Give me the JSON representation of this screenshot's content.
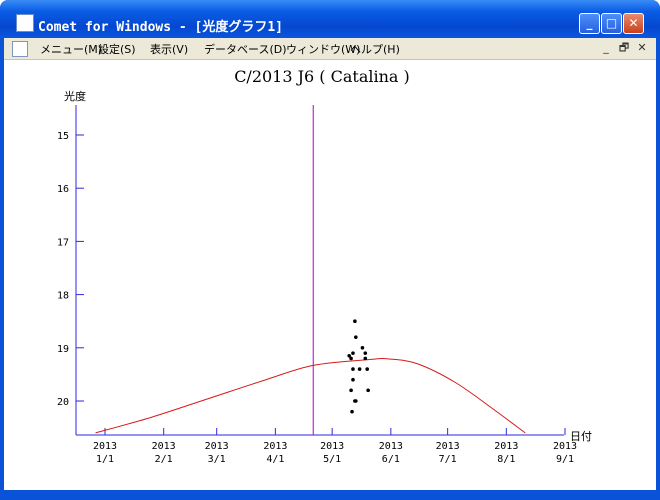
{
  "window": {
    "title": "Comet for Windows - [光度グラフ1]",
    "controls": [
      "_",
      "□",
      "✕"
    ]
  },
  "menu": {
    "items": [
      "メニュー(M)",
      "設定(S)",
      "表示(V)",
      "データベース(D)",
      "ウィンドウ(W)",
      "ヘルプ(H)"
    ],
    "mdi_controls": [
      "_",
      "🗗",
      "✕"
    ]
  },
  "chart_data": {
    "type": "scatter",
    "title": "C/2013 J6 ( Catalina )",
    "ylabel": "光度",
    "xlabel": "日付",
    "y_ticks": [
      "15",
      "16",
      "17",
      "18",
      "19",
      "20"
    ],
    "x_ticks": [
      {
        "year": "2013",
        "day": "1/1"
      },
      {
        "year": "2013",
        "day": "2/1"
      },
      {
        "year": "2013",
        "day": "3/1"
      },
      {
        "year": "2013",
        "day": "4/1"
      },
      {
        "year": "2013",
        "day": "5/1"
      },
      {
        "year": "2013",
        "day": "6/1"
      },
      {
        "year": "2013",
        "day": "7/1"
      },
      {
        "year": "2013",
        "day": "8/1"
      },
      {
        "year": "2013",
        "day": "9/1"
      }
    ],
    "y_inverted": true,
    "ylim": [
      14.5,
      20.6
    ],
    "xlim_days": [
      -10,
      245
    ],
    "date_marker_day": 110,
    "observations": [
      {
        "day": 132.0,
        "mag": 18.5
      },
      {
        "day": 132.5,
        "mag": 18.8
      },
      {
        "day": 131.0,
        "mag": 19.1
      },
      {
        "day": 129.0,
        "mag": 19.15
      },
      {
        "day": 136.0,
        "mag": 19.0
      },
      {
        "day": 137.5,
        "mag": 19.1
      },
      {
        "day": 137.5,
        "mag": 19.2
      },
      {
        "day": 130.0,
        "mag": 19.2
      },
      {
        "day": 131.0,
        "mag": 19.4
      },
      {
        "day": 134.5,
        "mag": 19.4
      },
      {
        "day": 138.5,
        "mag": 19.4
      },
      {
        "day": 131.0,
        "mag": 19.6
      },
      {
        "day": 130.0,
        "mag": 19.8
      },
      {
        "day": 139.0,
        "mag": 19.8
      },
      {
        "day": 132.5,
        "mag": 20.0
      },
      {
        "day": 132.0,
        "mag": 20.0
      },
      {
        "day": 130.5,
        "mag": 20.2
      }
    ],
    "predicted_curve": [
      {
        "day": -5,
        "mag": 20.6
      },
      {
        "day": 25,
        "mag": 20.3
      },
      {
        "day": 55,
        "mag": 19.95
      },
      {
        "day": 85,
        "mag": 19.6
      },
      {
        "day": 110,
        "mag": 19.33
      },
      {
        "day": 140,
        "mag": 19.22
      },
      {
        "day": 150,
        "mag": 19.21
      },
      {
        "day": 165,
        "mag": 19.3
      },
      {
        "day": 185,
        "mag": 19.65
      },
      {
        "day": 205,
        "mag": 20.15
      },
      {
        "day": 222,
        "mag": 20.6
      }
    ],
    "colors": {
      "axis": "#2a2ae0",
      "curve": "#d61a1a",
      "marker": "#b000c0",
      "points": "#000000"
    }
  }
}
